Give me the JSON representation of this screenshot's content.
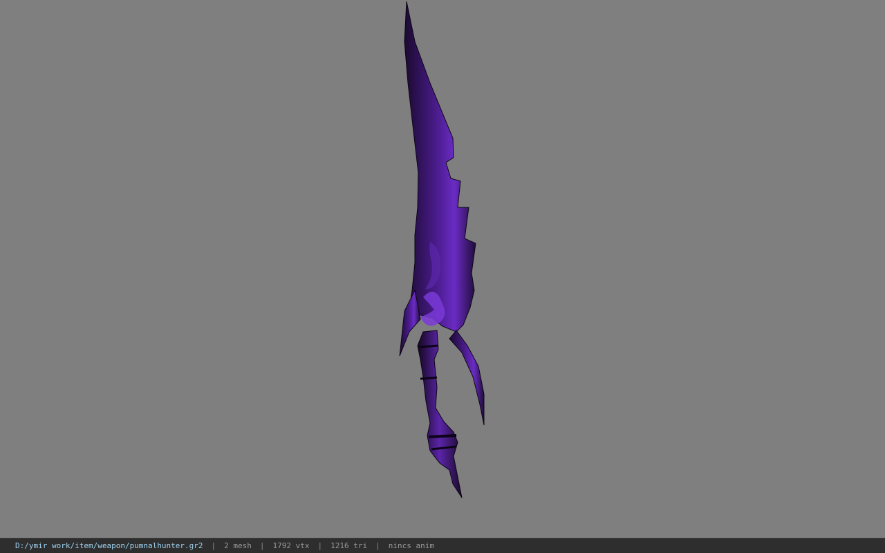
{
  "viewport": {
    "background": "#7f7f7f",
    "model_color": "#4b1f8a"
  },
  "statusbar": {
    "file_path": "D:/ymir work/item/weapon/pumnalhunter.gr2",
    "separator": "|",
    "mesh_count": "2 mesh",
    "vertex_count": "1792 vtx",
    "triangle_count": "1216 tri",
    "anim_status": "nincs anim"
  }
}
